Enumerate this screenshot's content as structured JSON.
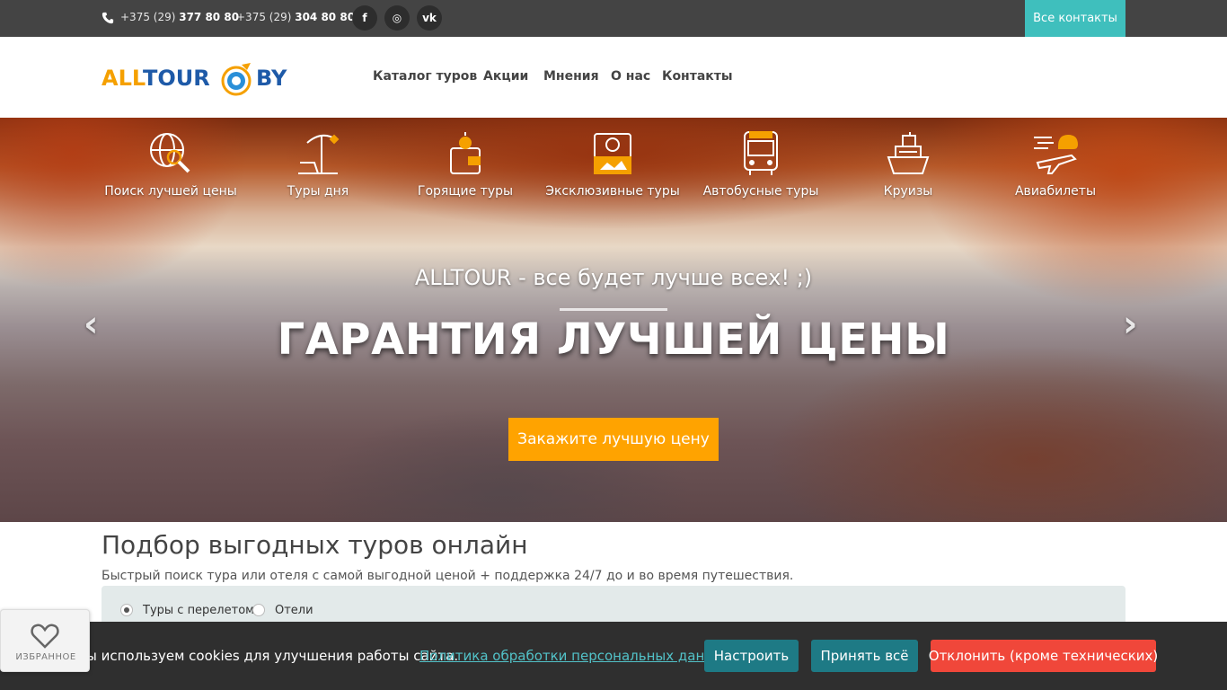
{
  "topbar": {
    "phone1_prefix": "+375 (29)",
    "phone1_number": "377 80 80",
    "phone2_prefix": "+375 (29)",
    "phone2_number": "304 80 80",
    "social": [
      "f",
      "◎",
      "vk"
    ],
    "all_contacts": "Все контакты"
  },
  "header": {
    "logo": {
      "part1": "ALL",
      "part2": "TOUR",
      "part3": "BY"
    },
    "nav": [
      "Каталог туров",
      "Акции",
      "Мнения",
      "О нас",
      "Контакты"
    ]
  },
  "hero": {
    "categories": [
      {
        "label": "Поиск лучшей цены",
        "icon": "globe-search-icon"
      },
      {
        "label": "Туры дня",
        "icon": "beach-umbrella-icon"
      },
      {
        "label": "Горящие туры",
        "icon": "wallet-fire-icon"
      },
      {
        "label": "Эксклюзивные туры",
        "icon": "camera-photo-icon"
      },
      {
        "label": "Автобусные туры",
        "icon": "bus-icon"
      },
      {
        "label": "Круизы",
        "icon": "ship-icon"
      },
      {
        "label": "Авиабилеты",
        "icon": "plane-cloud-icon"
      }
    ],
    "tagline": "ALLTOUR - все будет лучше всех! ;)",
    "headline": "ГАРАНТИЯ ЛУЧШЕЙ ЦЕНЫ",
    "cta": "Закажите лучшую цену",
    "prev_arrow": "‹",
    "next_arrow": "›"
  },
  "search": {
    "title": "Подбор выгодных туров онлайн",
    "subtitle": "Быстрый поиск тура или отеля с самой выгодной ценой + поддержка 24/7 до и во время путешествия.",
    "options": [
      {
        "label": "Туры с перелетом",
        "selected": true
      },
      {
        "label": "Отели",
        "selected": false
      }
    ]
  },
  "cookie": {
    "text": "ы используем cookies для улучшения работы сайта.",
    "policy_link": "Политика обработки персональных данных",
    "configure": "Настроить",
    "accept_all": "Принять всё",
    "reject": "Отклонить (кроме технических)"
  },
  "favorites": {
    "label": "ИЗБРАННОЕ"
  },
  "colors": {
    "accent_teal": "#3fbfbd",
    "cta_orange": "#ffa300",
    "reject_red": "#f0473a",
    "button_teal": "#1e7a85"
  }
}
